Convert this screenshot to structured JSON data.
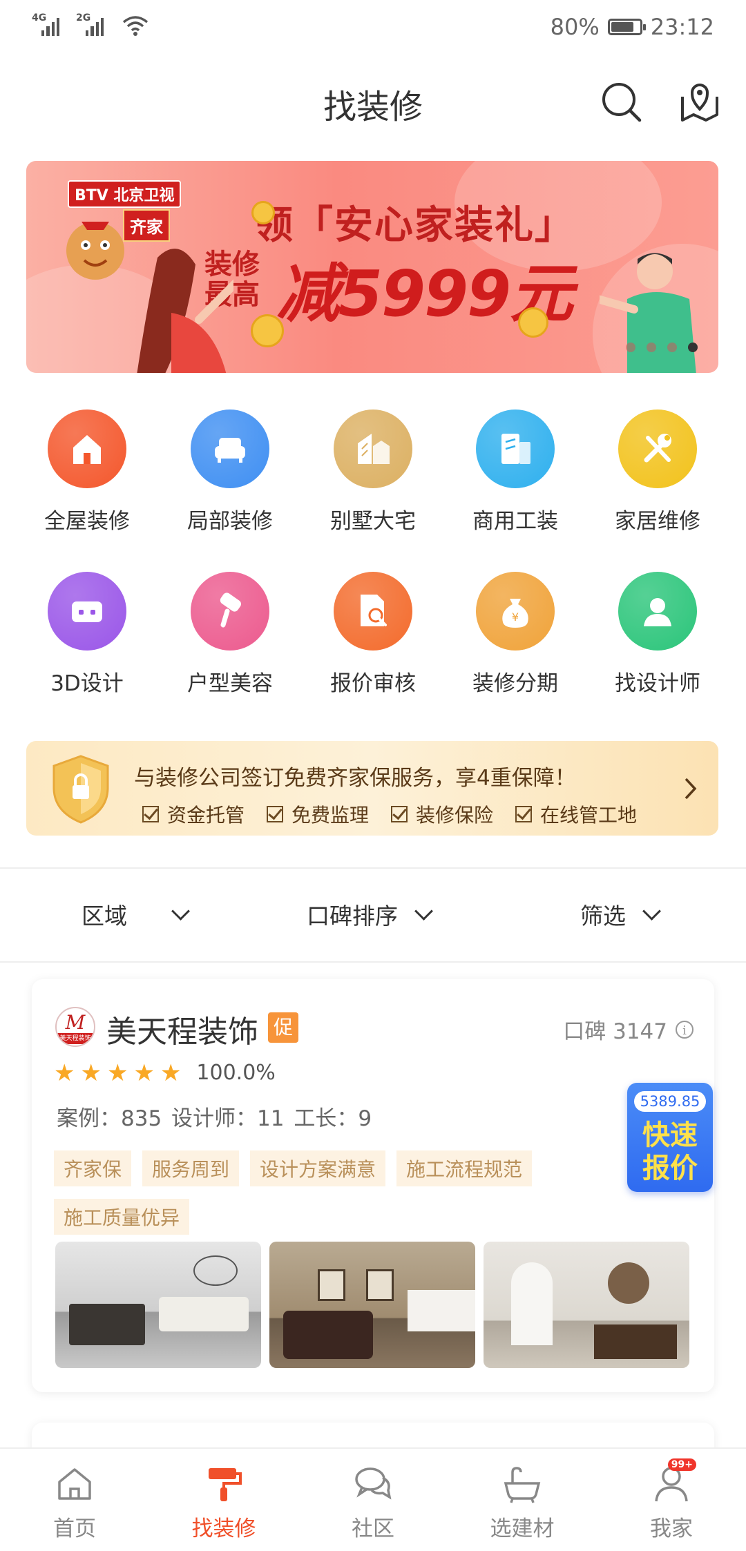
{
  "status_bar": {
    "signal1": "4G",
    "signal2": "2G",
    "battery_pct": "80%",
    "battery_level": 0.8,
    "time": "23:12"
  },
  "header": {
    "title": "找装修"
  },
  "banner": {
    "logo_btv": "BTV 北京卫视",
    "logo_qijia": "齐家",
    "line1": "领「安心家装礼」",
    "line2_small": "装修\n最高",
    "line2_big": "减5999元",
    "active_slide": 4,
    "slide_count": 4
  },
  "categories": [
    {
      "label": "全屋装修",
      "icon": "house-icon",
      "color": "#f4572c"
    },
    {
      "label": "局部装修",
      "icon": "sofa-icon",
      "color": "#3f8ff2"
    },
    {
      "label": "别墅大宅",
      "icon": "villa-icon",
      "color": "#dcb062"
    },
    {
      "label": "商用工装",
      "icon": "building-icon",
      "color": "#2fb0ee"
    },
    {
      "label": "家居维修",
      "icon": "wrench-icon",
      "color": "#f2c21b"
    },
    {
      "label": "3D设计",
      "icon": "vr-glasses-icon",
      "color": "#9a56e8"
    },
    {
      "label": "户型美容",
      "icon": "paint-roller-icon",
      "color": "#ec5a8e"
    },
    {
      "label": "报价审核",
      "icon": "document-search-icon",
      "color": "#f36b2c"
    },
    {
      "label": "装修分期",
      "icon": "money-bag-icon",
      "color": "#f0a33a"
    },
    {
      "label": "找设计师",
      "icon": "designer-icon",
      "color": "#2bc57a"
    }
  ],
  "guarantee": {
    "title": "与装修公司签订免费齐家保服务，享4重保障！",
    "items": [
      "资金托管",
      "免费监理",
      "装修保险",
      "在线管工地"
    ]
  },
  "filters": {
    "area": "区域",
    "sort": "口碑排序",
    "filter": "筛选"
  },
  "company": {
    "name": "美天程装饰",
    "promo_badge": "促",
    "logo_mark": "M",
    "logo_sub": "美天程装饰",
    "reputation": "口碑 3147",
    "rating": 5,
    "rating_pct": "100.0%",
    "stats": "案例：835   设计师：11   工长：9",
    "tags": [
      "齐家保",
      "服务周到",
      "设计方案满意",
      "施工流程规范",
      "施工质量优异"
    ]
  },
  "quick_quote": {
    "price": "5389.85",
    "label": "快速\n报价"
  },
  "tabbar": [
    {
      "label": "首页",
      "icon": "home-icon",
      "active": false
    },
    {
      "label": "找装修",
      "icon": "paint-roller-icon",
      "active": true
    },
    {
      "label": "社区",
      "icon": "chat-bubbles-icon",
      "active": false
    },
    {
      "label": "选建材",
      "icon": "bathtub-icon",
      "active": false
    },
    {
      "label": "我家",
      "icon": "profile-icon",
      "active": false,
      "badge": "99+"
    }
  ]
}
